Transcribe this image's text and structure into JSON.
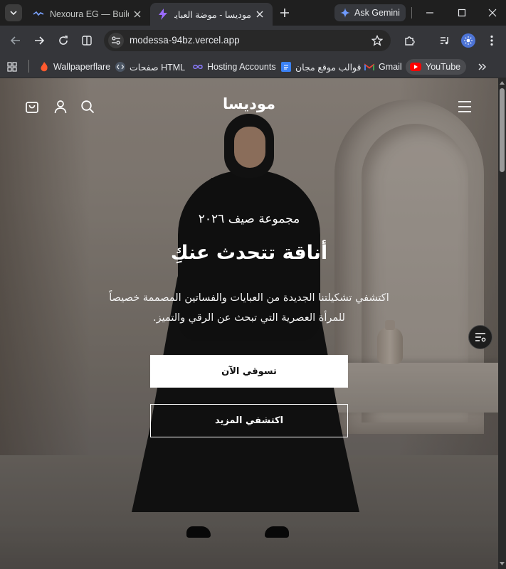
{
  "browser": {
    "tabs": [
      {
        "title": "Nexoura EG — Buildin",
        "icon": "nexoura-favicon"
      },
      {
        "title": "موديسا - موضة العبايات",
        "icon": "lightning-favicon"
      }
    ],
    "gemini_label": "Ask Gemini",
    "url": "modessa-94bz.vercel.app",
    "bookmarks": [
      {
        "label": "Wallpaperflare",
        "icon": "wallpaperflare-icon"
      },
      {
        "label": "صفحات HTML",
        "icon": "code-icon"
      },
      {
        "label": "Hosting Accounts",
        "icon": "infinity-icon"
      },
      {
        "label": "قوالب موقع مجان",
        "icon": "docs-icon"
      },
      {
        "label": "Gmail",
        "icon": "gmail-icon"
      },
      {
        "label": "YouTube",
        "icon": "youtube-icon"
      }
    ]
  },
  "site": {
    "logo": "موديسا",
    "hero": {
      "subtitle": "مجموعة صيف ٢٠٢٦",
      "title": "أناقة تتحدث عنكِ",
      "description_line1": "اكتشفي تشكيلتنا الجديدة من العبايات والفساتين المصممة خصيصاً",
      "description_line2": "للمرأة العصرية التي تبحث عن الرقي والتميز.",
      "primary_button": "تسوقي الآن",
      "secondary_button": "اكتشفي المزيد"
    }
  },
  "colors": {
    "browser_frame": "#1f1f1f",
    "toolbar": "#35363a",
    "accent_blue": "#4d74d6",
    "hero_text": "#ffffff"
  }
}
